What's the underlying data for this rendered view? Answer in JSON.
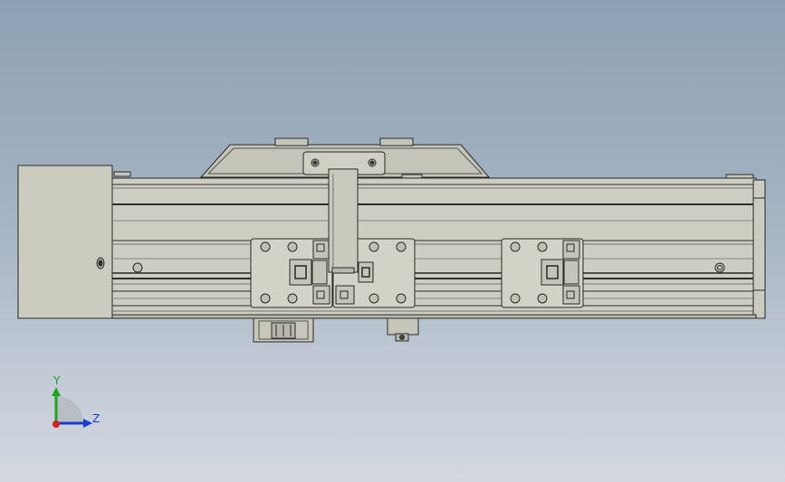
{
  "viewport": {
    "background_top": "#8da1b4",
    "background_bottom": "#d3d8e0",
    "model_face_color": "#c9c9bd",
    "model_edge_color": "#2a2a2a"
  },
  "triad": {
    "y_label": "Y",
    "z_label": "Z",
    "y_color": "#1aa81a",
    "z_color": "#1a3ccc",
    "x_color": "#d42020"
  }
}
